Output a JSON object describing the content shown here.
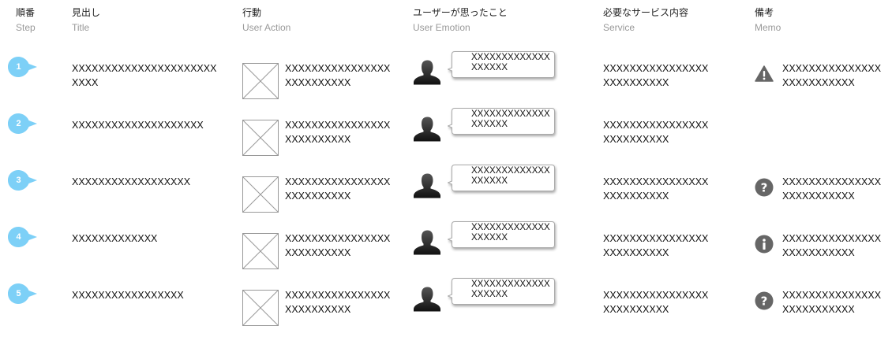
{
  "headers": [
    {
      "jp": "順番",
      "en": "Step"
    },
    {
      "jp": "見出し",
      "en": "Title"
    },
    {
      "jp": "行動",
      "en": "User Action"
    },
    {
      "jp": "ユーザーが思ったこと",
      "en": "User Emotion"
    },
    {
      "jp": "必要なサービス内容",
      "en": "Service"
    },
    {
      "jp": "備考",
      "en": "Memo"
    }
  ],
  "colors": {
    "step_marker": "#7dd0f7",
    "icon_gray": "#666666",
    "placeholder_border": "#999999"
  },
  "rows": [
    {
      "step": "1",
      "title": "XXXXXXXXXXXXXXXXXXXXXXXXXX",
      "action": "XXXXXXXXXXXXXXXXXXXXXXXXXX",
      "emotion": "XXXXXXXXXXXXXXXXXXX",
      "service": "XXXXXXXXXXXXXXXXXXXXXXXXXX",
      "memo_icon": "warning-icon",
      "memo": "XXXXXXXXXXXXXXXXXXXXXXXXXX"
    },
    {
      "step": "2",
      "title": "XXXXXXXXXXXXXXXXXXXX",
      "action": "XXXXXXXXXXXXXXXXXXXXXXXXXX",
      "emotion": "XXXXXXXXXXXXXXXXXXX",
      "service": "XXXXXXXXXXXXXXXXXXXXXXXXXX",
      "memo_icon": "",
      "memo": ""
    },
    {
      "step": "3",
      "title": "XXXXXXXXXXXXXXXXXX",
      "action": "XXXXXXXXXXXXXXXXXXXXXXXXXX",
      "emotion": "XXXXXXXXXXXXXXXXXXX",
      "service": "XXXXXXXXXXXXXXXXXXXXXXXXXX",
      "memo_icon": "question-icon",
      "memo": "XXXXXXXXXXXXXXXXXXXXXXXXXX"
    },
    {
      "step": "4",
      "title": "XXXXXXXXXXXXX",
      "action": "XXXXXXXXXXXXXXXXXXXXXXXXXX",
      "emotion": "XXXXXXXXXXXXXXXXXXX",
      "service": "XXXXXXXXXXXXXXXXXXXXXXXXXX",
      "memo_icon": "info-icon",
      "memo": "XXXXXXXXXXXXXXXXXXXXXXXXXX"
    },
    {
      "step": "5",
      "title": "XXXXXXXXXXXXXXXXX",
      "action": "XXXXXXXXXXXXXXXXXXXXXXXXXX",
      "emotion": "XXXXXXXXXXXXXXXXXXX",
      "service": "XXXXXXXXXXXXXXXXXXXXXXXXXX",
      "memo_icon": "question-icon",
      "memo": "XXXXXXXXXXXXXXXXXXXXXXXXXX"
    }
  ]
}
